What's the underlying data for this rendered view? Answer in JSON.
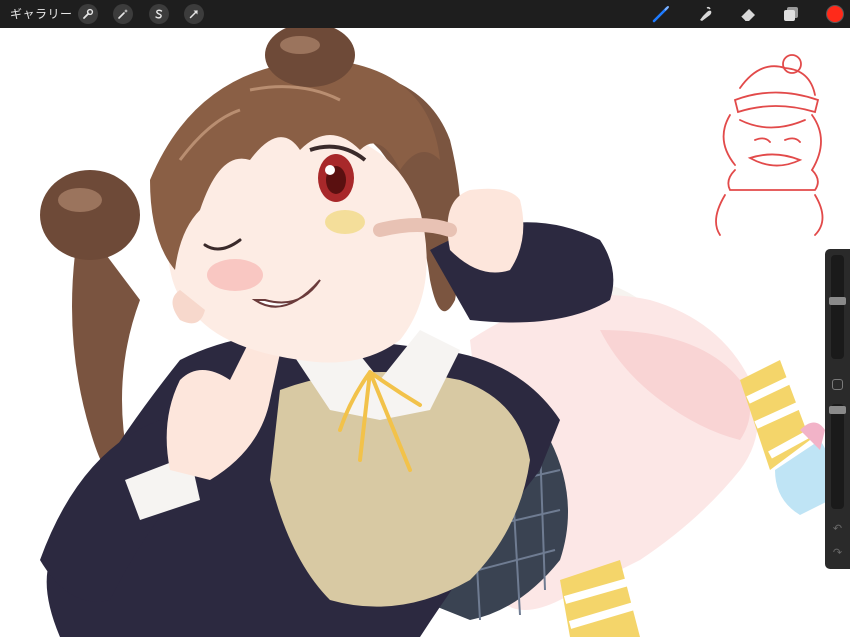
{
  "toolbar": {
    "gallery_label": "ギャラリー",
    "left_tools": [
      {
        "name": "actions",
        "icon": "wrench-icon"
      },
      {
        "name": "adjustments",
        "icon": "magic-wand-icon"
      },
      {
        "name": "selection",
        "icon": "selection-s-icon"
      },
      {
        "name": "transform",
        "icon": "arrow-cursor-icon"
      }
    ],
    "right_tools": [
      {
        "name": "brush",
        "icon": "brush-icon"
      },
      {
        "name": "smudge",
        "icon": "smudge-icon"
      },
      {
        "name": "eraser",
        "icon": "eraser-icon"
      },
      {
        "name": "layers",
        "icon": "layers-icon"
      }
    ],
    "active_tool": "brush",
    "current_color": "#ff2a1a"
  },
  "sidebar": {
    "brush_size_level": 0.44,
    "opacity_level": 0.02,
    "undo_icon": "undo-arrow-icon",
    "redo_icon": "redo-arrow-icon"
  },
  "colors": {
    "toolbar_bg": "#1e1e1e",
    "accent_blue": "#1e7bff",
    "sketch_red": "#e24a4a"
  }
}
